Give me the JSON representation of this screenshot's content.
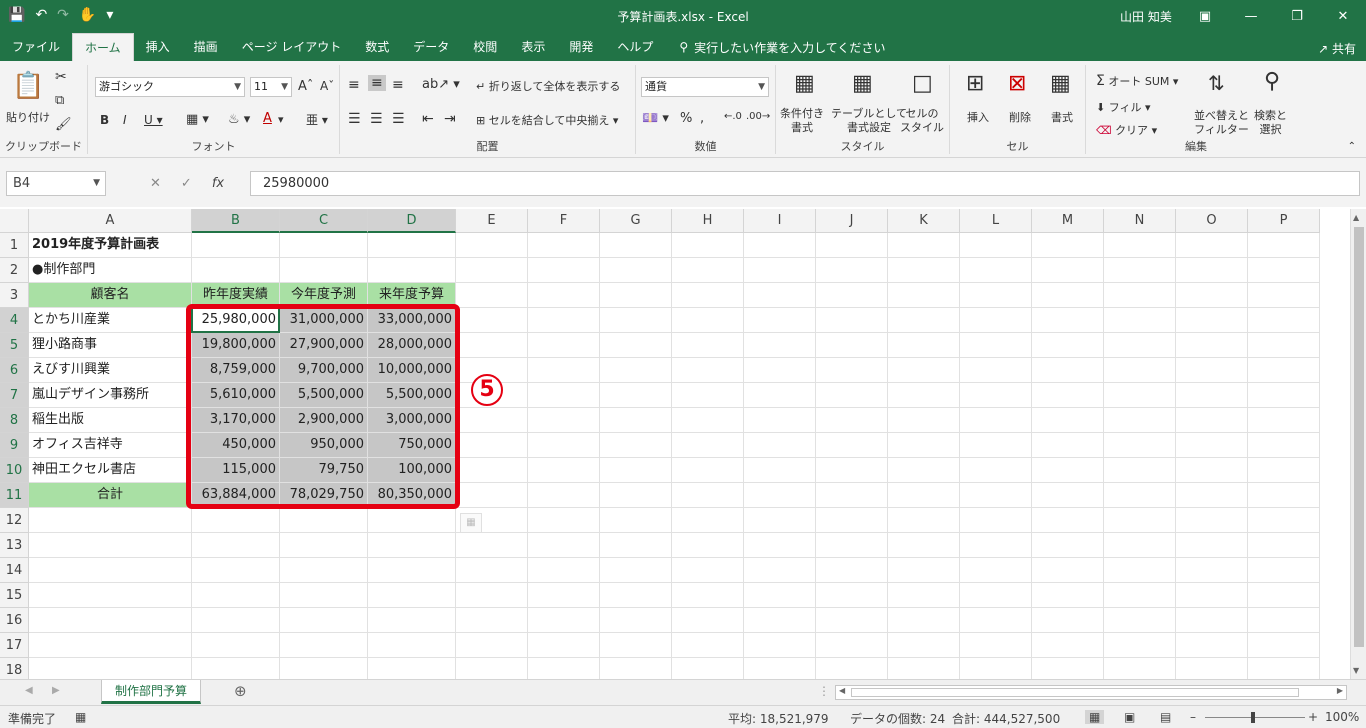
{
  "window": {
    "title": "予算計画表.xlsx  -  Excel",
    "user": "山田 知美"
  },
  "tabs": [
    "ファイル",
    "ホーム",
    "挿入",
    "描画",
    "ページ レイアウト",
    "数式",
    "データ",
    "校閲",
    "表示",
    "開発",
    "ヘルプ"
  ],
  "tellme": "実行したい作業を入力してください",
  "share": "共有",
  "ribbon": {
    "clipboard": {
      "label": "クリップボード",
      "paste": "貼り付け"
    },
    "font": {
      "label": "フォント",
      "name": "游ゴシック",
      "size": "11"
    },
    "align": {
      "label": "配置",
      "wrap": "折り返して全体を表示する",
      "merge": "セルを結合して中央揃え"
    },
    "number": {
      "label": "数値",
      "format": "通貨"
    },
    "styles": {
      "label": "スタイル",
      "cond": "条件付き\n書式",
      "table": "テーブルとして\n書式設定",
      "cell": "セルの\nスタイル"
    },
    "cells": {
      "label": "セル",
      "insert": "挿入",
      "delete": "削除",
      "format": "書式"
    },
    "editing": {
      "label": "編集",
      "autosum": "オート SUM",
      "fill": "フィル",
      "clear": "クリア",
      "sort": "並べ替えと\nフィルター",
      "find": "検索と\n選択"
    }
  },
  "formula": {
    "namebox": "B4",
    "value": "25980000"
  },
  "columns": [
    "A",
    "B",
    "C",
    "D",
    "E",
    "F",
    "G",
    "H",
    "I",
    "J",
    "K",
    "L",
    "M",
    "N",
    "O",
    "P"
  ],
  "rows": [
    "1",
    "2",
    "3",
    "4",
    "5",
    "6",
    "7",
    "8",
    "9",
    "10",
    "11",
    "12",
    "13",
    "14",
    "15",
    "16",
    "17",
    "18"
  ],
  "sheet": {
    "title": "2019年度予算計画表",
    "dept": "●制作部門",
    "headers": [
      "顧客名",
      "昨年度実績",
      "今年度予測",
      "来年度予算"
    ],
    "data": [
      [
        "とかち川産業",
        "25,980,000",
        "31,000,000",
        "33,000,000"
      ],
      [
        "狸小路商事",
        "19,800,000",
        "27,900,000",
        "28,000,000"
      ],
      [
        "えびす川興業",
        "8,759,000",
        "9,700,000",
        "10,000,000"
      ],
      [
        "嵐山デザイン事務所",
        "5,610,000",
        "5,500,000",
        "5,500,000"
      ],
      [
        "稲生出版",
        "3,170,000",
        "2,900,000",
        "3,000,000"
      ],
      [
        "オフィス吉祥寺",
        "450,000",
        "950,000",
        "750,000"
      ],
      [
        "神田エクセル書店",
        "115,000",
        "79,750",
        "100,000"
      ]
    ],
    "total": [
      "合計",
      "63,884,000",
      "78,029,750",
      "80,350,000"
    ]
  },
  "annotation": "5",
  "sheet_tab": "制作部門予算",
  "status": {
    "ready": "準備完了",
    "avg": "平均: 18,521,979",
    "count": "データの個数: 24",
    "sum": "合計: 444,527,500",
    "zoom": "100%"
  }
}
